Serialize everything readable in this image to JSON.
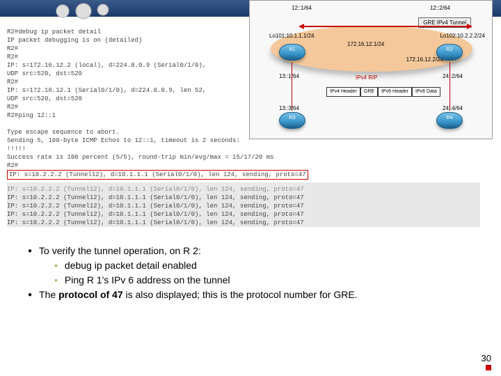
{
  "diagram": {
    "addr_top_left": "12::1/64",
    "addr_top_right": "12::2/64",
    "tunnel_label": "GRE IPv4 Tunnel",
    "lo101": "Lo101:10.1.1.1/24",
    "lo102": "Lo102:10.2.2.2/24",
    "mid_subnet": "172.16.12.1/24",
    "mid_subnet_r": "172.16.12.2/24",
    "ipv4_rip": "IPv4 RIP",
    "left_mid": "13::1/64",
    "right_mid": "24::2/64",
    "left_bot": "13::3/64",
    "right_bot": "24::4/64",
    "r1": "R1",
    "r2": "R2",
    "r3": "R3",
    "r4": "R4",
    "pk1": "IPv4\nHeader",
    "pk2": "GRE",
    "pk3": "IPv6\nHeader",
    "pk4": "IPv6 Data"
  },
  "terminal": [
    "R2#debug ip packet detail",
    "IP packet debugging is on (detailed)",
    "R2#",
    "R2#",
    "IP: s=172.16.12.2 (local), d=224.0.0.9 (Serial0/1/0),",
    "    UDP src=520, dst=520",
    "R2#",
    "IP: s=172.16.12.1 (Serial0/1/0), d=224.0.0.9, len 52,",
    "    UDP src=520, dst=520",
    "R2#",
    "R2#ping 12::1",
    "",
    "Type escape sequence to abort.",
    "Sending 5, 100-byte ICMP Echos to 12::1, timeout is 2 seconds:",
    "!!!!!",
    "Success rate is 100 percent (5/5), round-trip min/avg/max = 15/17/20 ms",
    "R2#"
  ],
  "terminal_hl": "IP: s=10.2.2.2 (Tunnel12), d=10.1.1.1 (Serial0/1/0), len 124, sending, proto=47",
  "terminal_shade": [
    "IP: s=10.2.2.2 (Tunnel12), d=10.1.1.1 (Serial0/1/0), len 124, sending, proto=47",
    "IP: s=10.2.2.2 (Tunnel12), d=10.1.1.1 (Serial0/1/0), len 124, sending, proto=47",
    "IP: s=10.2.2.2 (Tunnel12), d=10.1.1.1 (Serial0/1/0), len 124, sending, proto=47",
    "IP: s=10.2.2.2 (Tunnel12), d=10.1.1.1 (Serial0/1/0), len 124, sending, proto=47",
    "IP: s=10.2.2.2 (Tunnel12), d=10.1.1.1 (Serial0/1/0), len 124, sending, proto=47"
  ],
  "bullets": {
    "line1": "To verify the tunnel operation, on R 2:",
    "line1a": "debug ip packet detail enabled",
    "line1b": "Ping R 1's IPv 6 address on the tunnel",
    "line2a": "The ",
    "line2b": "protocol of 47",
    "line2c": " is also displayed; this is the protocol number for GRE."
  },
  "page_number": "30"
}
